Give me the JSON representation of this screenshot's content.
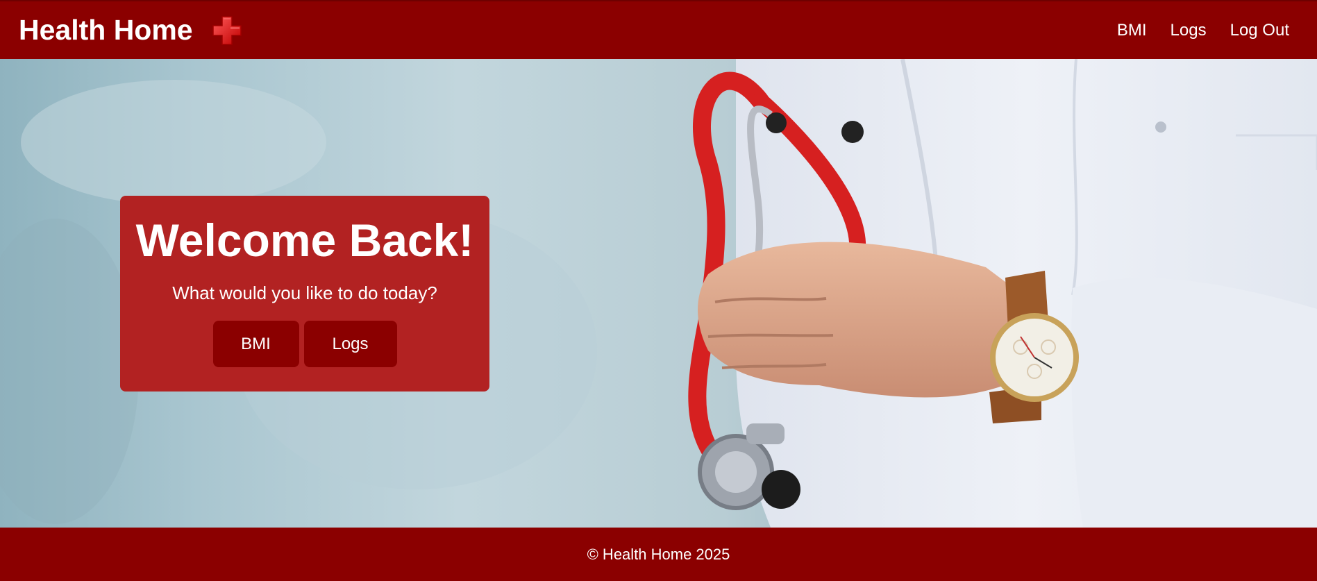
{
  "navbar": {
    "brand_title": "Health Home",
    "brand_icon": "red-cross-icon",
    "links": [
      "BMI",
      "Logs",
      "Log Out"
    ]
  },
  "hero": {
    "background_image": "doctor-with-stethoscope-photo",
    "card": {
      "title": "Welcome Back!",
      "subtitle": "What would you like to do today?",
      "buttons": [
        "BMI",
        "Logs"
      ]
    }
  },
  "footer": {
    "text": "© Health Home 2025"
  },
  "colors": {
    "primary": "#8b0000",
    "card": "#b22222",
    "text": "#ffffff"
  }
}
